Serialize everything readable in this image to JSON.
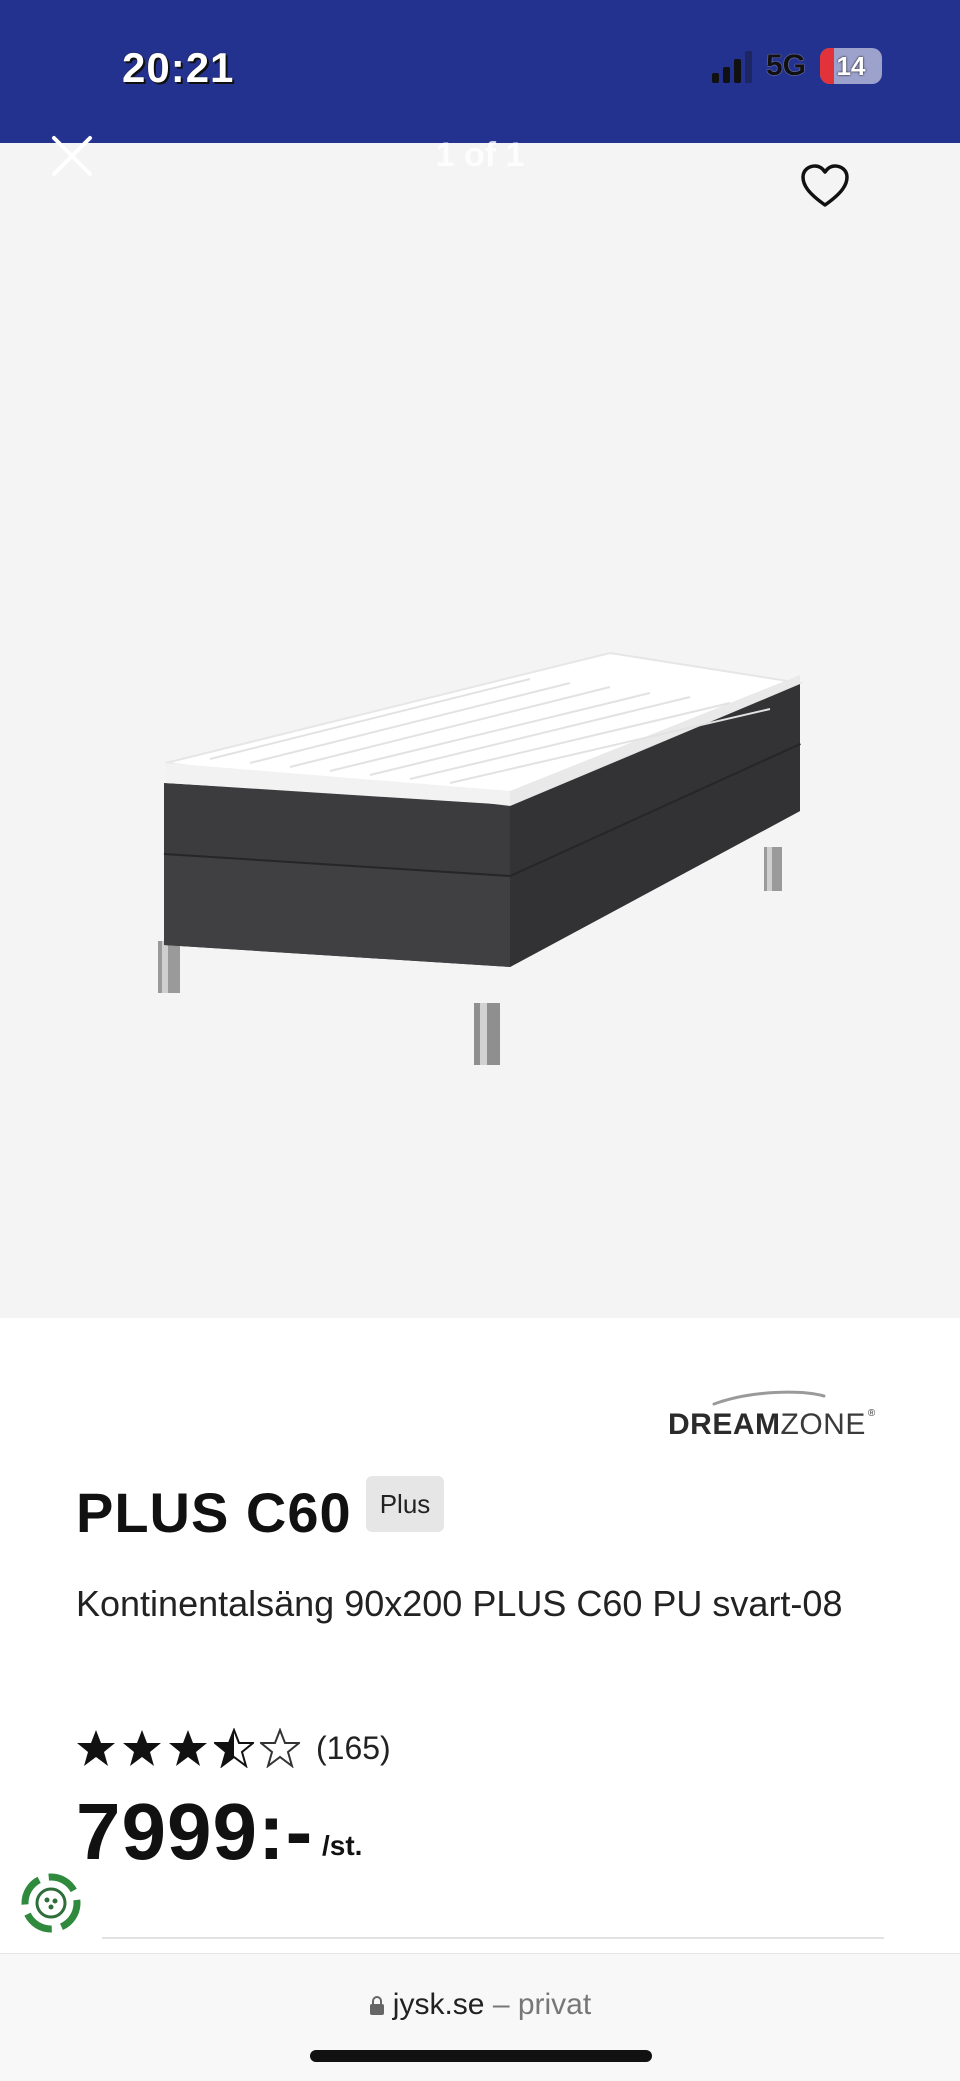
{
  "status_bar": {
    "time": "20:21",
    "network": "5G",
    "battery": "14"
  },
  "gallery": {
    "counter": "1 of 1",
    "close_icon": "close-icon",
    "favorite_icon": "heart-icon"
  },
  "product": {
    "brand": {
      "bold": "DREAM",
      "light": "ZONE",
      "mark": "®"
    },
    "name": "PLUS C60",
    "badge": "Plus",
    "description": "Kontinentalsäng 90x200 PLUS C60 PU svart-08",
    "rating_value": 3.5,
    "reviews": "(165)",
    "price": "7999:-",
    "unit": "/st."
  },
  "browser": {
    "domain": "jysk.se",
    "separator": "–",
    "mode": "privat"
  },
  "colors": {
    "header": "#24328f",
    "image_bg": "#f4f4f4",
    "text": "#111111"
  }
}
